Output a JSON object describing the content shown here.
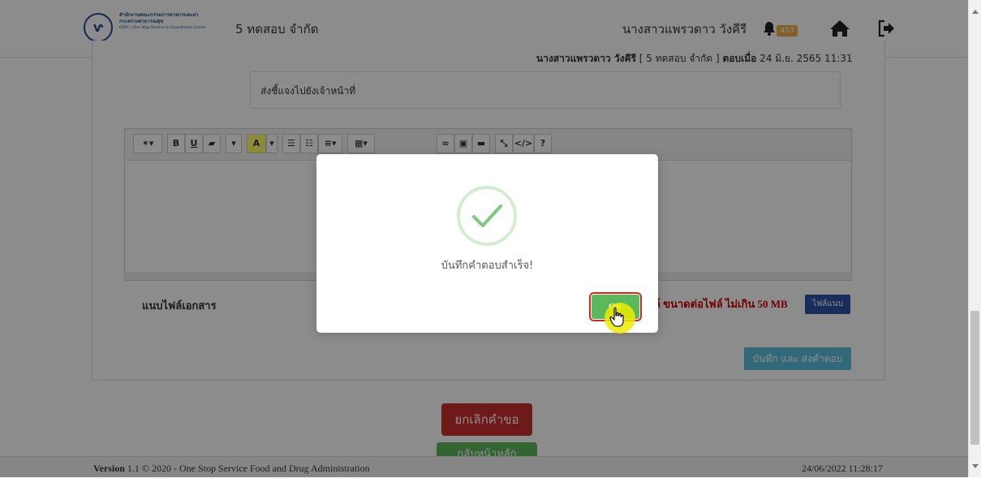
{
  "header": {
    "logo_text_line1": "สำนักงานคณะกรรมการอาหารและยา",
    "logo_text_line2": "กระทรวงสาธารณสุข",
    "logo_text_line3": "OSSC | One Stop Service & Consultation Center",
    "company": "5 ทดสอบ จำกัด",
    "username": "นางสาวแพรวดาว วังคีรี",
    "notification_count": "453"
  },
  "reply": {
    "author": "นางสาวแพรวดาว วังคีรี",
    "company_bracket": "[ 5 ทดสอบ จำกัด ]",
    "replied_label": "ตอบเมื่อ",
    "replied_at": "24 มิ.ย. 2565 11:31",
    "message": "ส่งชี้แจงไปยังเจ้าหน้าที่"
  },
  "toolbar": {
    "bold": "B",
    "underline": "U",
    "font_color": "A",
    "help": "?"
  },
  "form": {
    "attach_label": "แนบไฟล์เอกสาร",
    "size_note": "ล์ ขนาดต่อไฟล์ ไม่เกิน 50 MB",
    "attach_button": "ไฟล์แนบ",
    "send_button": "บันทึก และ ส่งคำตอบ"
  },
  "actions": {
    "cancel": "ยกเลิกคำขอ",
    "second": "กลับหน้าหลัก"
  },
  "footer": {
    "version_label": "Version",
    "version_text": "1.1 © 2020 - One Stop Service Food and Drug Administration",
    "datetime": "24/06/2022 11:28:17"
  },
  "modal": {
    "title": "บันทึกคำตอบสำเร็จ!",
    "ok_label": "OK"
  },
  "colors": {
    "success": "#5cb85c",
    "danger": "#c9302c",
    "info": "#5bc0de",
    "primary": "#2c53a5",
    "badge": "#f0ad4e"
  }
}
